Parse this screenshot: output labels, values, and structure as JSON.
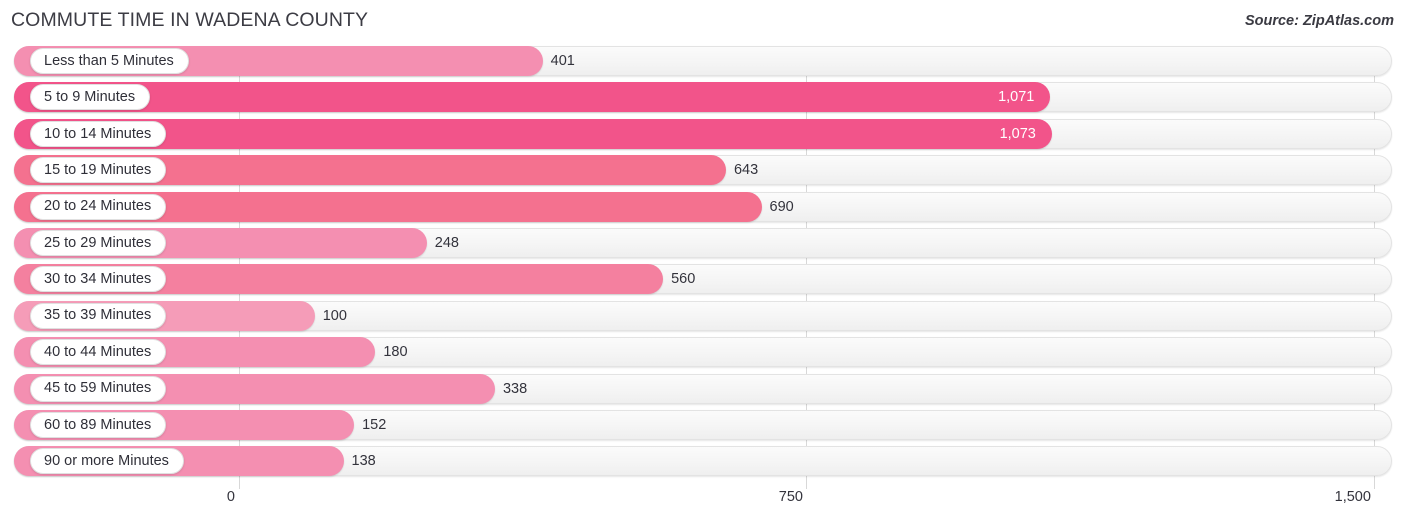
{
  "header": {
    "title": "COMMUTE TIME IN WADENA COUNTY",
    "source": "Source: ZipAtlas.com"
  },
  "colors": {
    "bar_strong": "#f2548a",
    "bar_light": "#f48fb1",
    "track": "#f5f5f5",
    "track_border": "#e3e3e3",
    "gridline": "#d8d8d8",
    "text": "#33333c",
    "value_inside": "#ffffff"
  },
  "axis": {
    "min": 0,
    "max": 1500,
    "ticks": [
      {
        "label": "0",
        "value": 0
      },
      {
        "label": "750",
        "value": 750
      },
      {
        "label": "1,500",
        "value": 1500
      }
    ]
  },
  "chart_data": {
    "type": "bar",
    "orientation": "horizontal",
    "title": "COMMUTE TIME IN WADENA COUNTY",
    "subtitle": "",
    "xlabel": "",
    "ylabel": "",
    "xlim": [
      0,
      1500
    ],
    "grid": true,
    "legend": null,
    "source": "Source: ZipAtlas.com",
    "categories": [
      "Less than 5 Minutes",
      "5 to 9 Minutes",
      "10 to 14 Minutes",
      "15 to 19 Minutes",
      "20 to 24 Minutes",
      "25 to 29 Minutes",
      "30 to 34 Minutes",
      "35 to 39 Minutes",
      "40 to 44 Minutes",
      "45 to 59 Minutes",
      "60 to 89 Minutes",
      "90 or more Minutes"
    ],
    "values": [
      401,
      1071,
      1073,
      643,
      690,
      248,
      560,
      100,
      180,
      338,
      152,
      138
    ],
    "value_labels": [
      "401",
      "1,071",
      "1,073",
      "643",
      "690",
      "248",
      "560",
      "100",
      "180",
      "338",
      "152",
      "138"
    ]
  },
  "rows": [
    {
      "label": "Less than 5 Minutes",
      "value": 401,
      "value_label": "401",
      "color": "#f48fb1",
      "inside": false
    },
    {
      "label": "5 to 9 Minutes",
      "value": 1071,
      "value_label": "1,071",
      "color": "#f2548a",
      "inside": true
    },
    {
      "label": "10 to 14 Minutes",
      "value": 1073,
      "value_label": "1,073",
      "color": "#f2548a",
      "inside": true
    },
    {
      "label": "15 to 19 Minutes",
      "value": 643,
      "value_label": "643",
      "color": "#f4718f",
      "inside": false
    },
    {
      "label": "20 to 24 Minutes",
      "value": 690,
      "value_label": "690",
      "color": "#f4718f",
      "inside": false
    },
    {
      "label": "25 to 29 Minutes",
      "value": 248,
      "value_label": "248",
      "color": "#f48fb1",
      "inside": false
    },
    {
      "label": "30 to 34 Minutes",
      "value": 560,
      "value_label": "560",
      "color": "#f4809f",
      "inside": false
    },
    {
      "label": "35 to 39 Minutes",
      "value": 100,
      "value_label": "100",
      "color": "#f59cb8",
      "inside": false
    },
    {
      "label": "40 to 44 Minutes",
      "value": 180,
      "value_label": "180",
      "color": "#f48fb1",
      "inside": false
    },
    {
      "label": "45 to 59 Minutes",
      "value": 338,
      "value_label": "338",
      "color": "#f48fb1",
      "inside": false
    },
    {
      "label": "60 to 89 Minutes",
      "value": 152,
      "value_label": "152",
      "color": "#f48fb1",
      "inside": false
    },
    {
      "label": "90 or more Minutes",
      "value": 138,
      "value_label": "138",
      "color": "#f48fb1",
      "inside": false
    }
  ]
}
